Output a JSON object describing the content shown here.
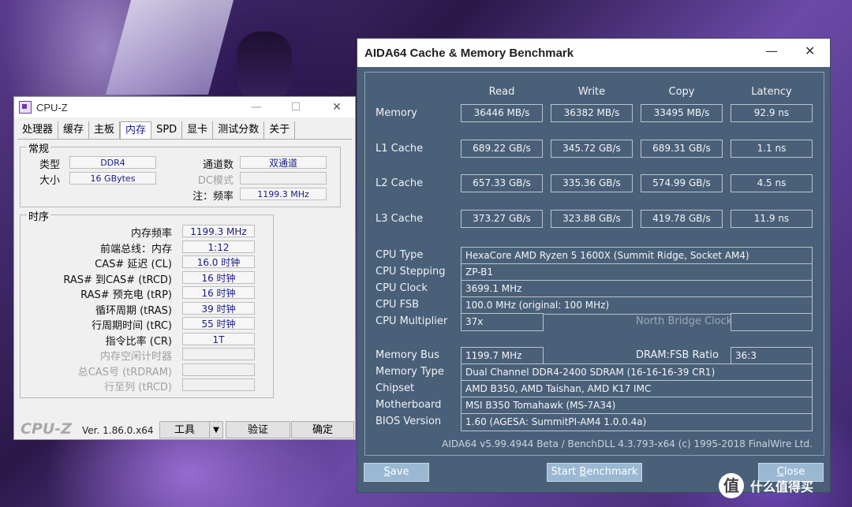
{
  "cpuz": {
    "title": "CPU-Z",
    "tabs": [
      "处理器",
      "缓存",
      "主板",
      "内存",
      "SPD",
      "显卡",
      "测试分数",
      "关于"
    ],
    "active_tab": "内存",
    "general": {
      "group_label": "常规",
      "type_label": "类型",
      "type_value": "DDR4",
      "size_label": "大小",
      "size_value": "16 GBytes",
      "channels_label": "通道数",
      "channels_value": "双通道",
      "dc_label": "DC模式",
      "dc_value": "",
      "note_label": "注：频率",
      "note_value": "1199.3 MHz"
    },
    "timings": {
      "group_label": "时序",
      "rows": [
        {
          "label": "内存频率",
          "value": "1199.3 MHz",
          "disabled": false
        },
        {
          "label": "前端总线：内存",
          "value": "1:12",
          "disabled": false
        },
        {
          "label": "CAS# 延迟 (CL)",
          "value": "16.0 时钟",
          "disabled": false
        },
        {
          "label": "RAS# 到CAS# (tRCD)",
          "value": "16 时钟",
          "disabled": false
        },
        {
          "label": "RAS# 预充电 (tRP)",
          "value": "16 时钟",
          "disabled": false
        },
        {
          "label": "循环周期 (tRAS)",
          "value": "39 时钟",
          "disabled": false
        },
        {
          "label": "行周期时间 (tRC)",
          "value": "55 时钟",
          "disabled": false
        },
        {
          "label": "指令比率 (CR)",
          "value": "1T",
          "disabled": false
        },
        {
          "label": "内存空闲计时器",
          "value": "",
          "disabled": true
        },
        {
          "label": "总CAS号 (tRDRAM)",
          "value": "",
          "disabled": true
        },
        {
          "label": "行至列 (tRCD)",
          "value": "",
          "disabled": true
        }
      ]
    },
    "brand": "CPU-Z",
    "version": "Ver. 1.86.0.x64",
    "tools_button": "工具",
    "validate_button": "验证",
    "ok_button": "确定"
  },
  "aida": {
    "title": "AIDA64 Cache & Memory Benchmark",
    "columns": [
      "Read",
      "Write",
      "Copy",
      "Latency"
    ],
    "bench_rows": [
      {
        "label": "Memory",
        "values": [
          "36446 MB/s",
          "36382 MB/s",
          "33495 MB/s",
          "92.9 ns"
        ]
      },
      {
        "label": "L1 Cache",
        "values": [
          "689.22 GB/s",
          "345.72 GB/s",
          "689.31 GB/s",
          "1.1 ns"
        ]
      },
      {
        "label": "L2 Cache",
        "values": [
          "657.33 GB/s",
          "335.36 GB/s",
          "574.99 GB/s",
          "4.5 ns"
        ]
      },
      {
        "label": "L3 Cache",
        "values": [
          "373.27 GB/s",
          "323.88 GB/s",
          "419.78 GB/s",
          "11.9 ns"
        ]
      }
    ],
    "cpu": {
      "type_label": "CPU Type",
      "type_value": "HexaCore AMD Ryzen 5 1600X  (Summit Ridge, Socket AM4)",
      "stepping_label": "CPU Stepping",
      "stepping_value": "ZP-B1",
      "clock_label": "CPU Clock",
      "clock_value": "3699.1 MHz",
      "fsb_label": "CPU FSB",
      "fsb_value": "100.0 MHz  (original: 100 MHz)",
      "mult_label": "CPU Multiplier",
      "mult_value": "37x",
      "nb_label": "North Bridge Clock",
      "nb_value": ""
    },
    "mem": {
      "bus_label": "Memory Bus",
      "bus_value": "1199.7 MHz",
      "ratio_label": "DRAM:FSB Ratio",
      "ratio_value": "36:3",
      "type_label": "Memory Type",
      "type_value": "Dual Channel DDR4-2400 SDRAM  (16-16-16-39 CR1)",
      "chipset_label": "Chipset",
      "chipset_value": "AMD B350, AMD Taishan, AMD K17 IMC",
      "mb_label": "Motherboard",
      "mb_value": "MSI B350 Tomahawk (MS-7A34)",
      "bios_label": "BIOS Version",
      "bios_value": "1.60  (AGESA: SummitPI-AM4 1.0.0.4a)"
    },
    "footer": "AIDA64 v5.99.4944 Beta / BenchDLL 4.3.793-x64  (c) 1995-2018 FinalWire Ltd.",
    "save_first": "S",
    "save_rest": "ave",
    "start_prefix": "Start ",
    "start_first": "B",
    "start_rest": "enchmark",
    "close_first": "C",
    "close_rest": "lose"
  },
  "watermark": {
    "badge": "值",
    "text": "什么值得买"
  }
}
